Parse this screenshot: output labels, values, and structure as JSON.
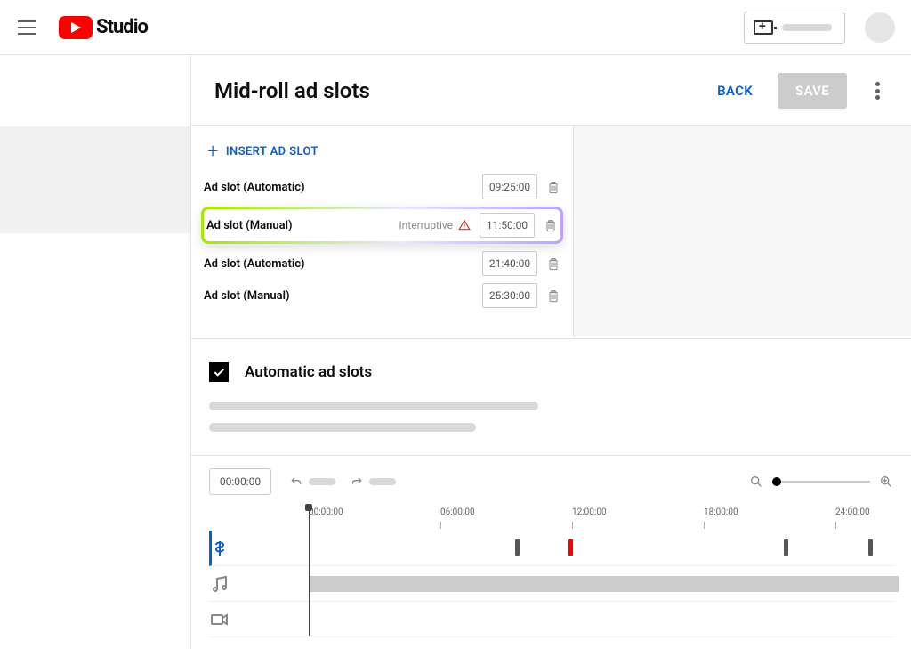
{
  "header": {
    "logo_text": "Studio"
  },
  "page": {
    "title": "Mid-roll ad slots",
    "back_label": "BACK",
    "save_label": "SAVE"
  },
  "insert_button": "INSERT AD SLOT",
  "slots": [
    {
      "label": "Ad slot (Automatic)",
      "time": "09:25:00"
    },
    {
      "label": "Ad slot (Manual)",
      "tag": "Interruptive",
      "time": "11:50:00",
      "highlighted": true,
      "warning": true
    },
    {
      "label": "Ad slot (Automatic)",
      "time": "21:40:00"
    },
    {
      "label": "Ad slot (Manual)",
      "time": "25:30:00"
    }
  ],
  "auto_section": {
    "title": "Automatic ad slots",
    "checked": true
  },
  "timeline": {
    "current": "00:00:00",
    "ticks": [
      "00:00:00",
      "06:00:00",
      "12:00:00",
      "18:00:00",
      "24:00:00"
    ]
  }
}
